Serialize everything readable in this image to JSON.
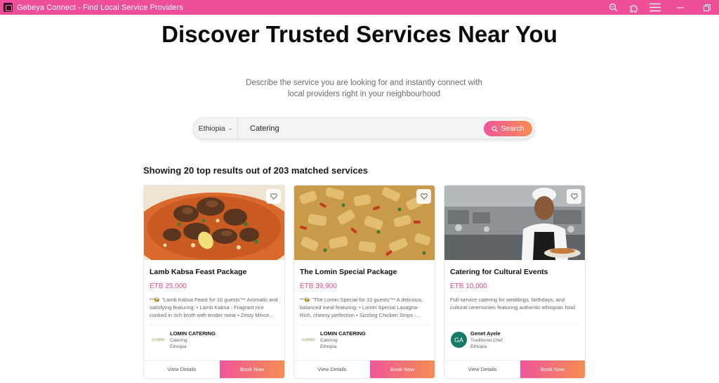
{
  "window": {
    "title": "Gebeya Connect - Find Local Service Providers",
    "icons": [
      "app-icon",
      "zoom-icon",
      "extensions-icon",
      "menu-icon",
      "minimize-icon",
      "restore-icon"
    ]
  },
  "hero": {
    "title": "Discover Trusted Services Near You",
    "subtitle": "Describe the service you are looking for and instantly connect with local providers right in your neighbourhood"
  },
  "search": {
    "country": "Ethiopia",
    "query": "Catering",
    "button_label": "Search"
  },
  "results": {
    "heading": "Showing 20 top results out of 203 matched services"
  },
  "cards": [
    {
      "name": "Lamb Kabsa Feast Package",
      "price": "ETB 25,000",
      "description": "**🐝 \"Lamb Kabsa Feast for 10 guests\"** Aromatic and satisfying featuring: • Lamb Kabsa - Fragrant rice cooked in rich broth with tender meat • Zesty Mince...",
      "provider": {
        "name": "LOMIN CATERING",
        "category": "Catering",
        "location": "Ethiopia",
        "logo": "LOMIN"
      },
      "view_label": "View Details",
      "book_label": "Book Now"
    },
    {
      "name": "The Lomin Special Package",
      "price": "ETB 39,900",
      "description": "**🐝 \"The Lomin Special for 10 guests\"** A delicious, balanced meal featuring: • Lomin Special Lasagna- Rich, cheesy perfection • Sizzling Chicken Strips -...",
      "provider": {
        "name": "LOMIN CATERING",
        "category": "Catering",
        "location": "Ethiopia",
        "logo": "LOMIN"
      },
      "view_label": "View Details",
      "book_label": "Book Now"
    },
    {
      "name": "Catering for Cultural Events",
      "price": "ETB 10,000",
      "description": "Full-service catering for weddings, birthdays, and cultural ceremonies featuring authentic ethiopian food.",
      "provider": {
        "name": "Genet Ayele",
        "category": "Traditional Chef",
        "location": "Ethiopia",
        "logo": "GA"
      },
      "view_label": "View Details",
      "book_label": "Book Now"
    }
  ],
  "colors": {
    "brand": "#ef4f98",
    "gradient_start": "#f0569a",
    "gradient_end": "#f58d52",
    "price": "#e14a8a",
    "avatar": "#127a66"
  }
}
